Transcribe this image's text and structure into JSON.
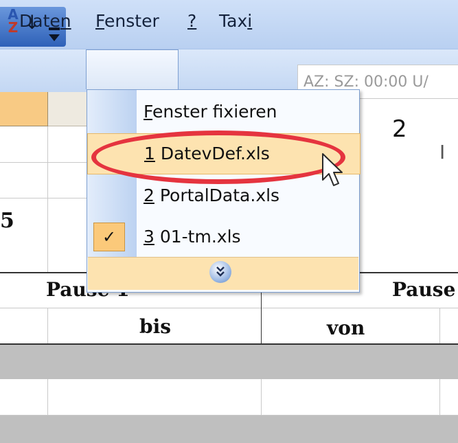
{
  "toolbar": {
    "sort_icon_top": "A",
    "sort_icon_bottom": "Z",
    "sort_arrow": "↓"
  },
  "menubar": {
    "items": [
      {
        "pre": "Date",
        "accel": "n",
        "post": ""
      },
      {
        "pre": "",
        "accel": "F",
        "post": "enster"
      },
      {
        "pre": "",
        "accel": "?",
        "post": ""
      },
      {
        "pre": "Tax",
        "accel": "i",
        "post": ""
      }
    ]
  },
  "status_box": {
    "text": "AZ: SZ: 00:00 U/"
  },
  "dropdown": {
    "items": [
      {
        "accel": "F",
        "rest": "enster fixieren",
        "checked": false,
        "highlighted": false
      },
      {
        "accel": "1",
        "rest": " DatevDef.xls",
        "checked": false,
        "highlighted": true
      },
      {
        "accel": "2",
        "rest": " PortalData.xls",
        "checked": false,
        "highlighted": false
      },
      {
        "accel": "3",
        "rest": " 01-tm.xls",
        "checked": true,
        "highlighted": false
      }
    ],
    "check_mark": "✓",
    "expand_glyph": "»"
  },
  "sheet": {
    "num_right": "2",
    "num_left": "5",
    "bar_right": "I",
    "pause1": "Pause 1",
    "pause2": "Pause",
    "bis": "bis",
    "von": "von"
  },
  "colors": {
    "highlight_ring": "#e5343f",
    "menu_hover": "#fde3b0",
    "toolbar_blue": "#2e61b8"
  }
}
